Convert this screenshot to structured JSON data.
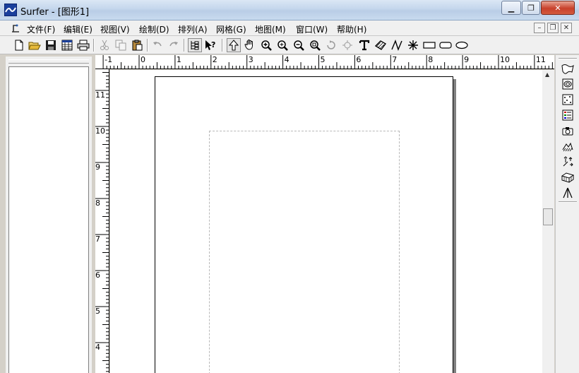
{
  "window": {
    "title": "Surfer - [图形1]"
  },
  "menubar": {
    "items": [
      "文件(F)",
      "编辑(E)",
      "视图(V)",
      "绘制(D)",
      "排列(A)",
      "网格(G)",
      "地图(M)",
      "窗口(W)",
      "帮助(H)"
    ]
  },
  "toolbar": {
    "buttons": [
      "new-document",
      "open-folder",
      "save",
      "worksheet",
      "print",
      "cut",
      "copy",
      "paste",
      "undo",
      "redo",
      "object-manager",
      "context-help",
      "select-arrow",
      "pan-hand",
      "zoom-in",
      "zoom-rectangle",
      "zoom-out",
      "zoom-page",
      "rotate",
      "reshape",
      "text",
      "polygon",
      "polyline",
      "symbol",
      "rectangle",
      "rounded-rectangle",
      "ellipse"
    ]
  },
  "ruler_h": {
    "labels": [
      "-1",
      "0",
      "1",
      "2",
      "3",
      "4",
      "5",
      "6",
      "7",
      "8",
      "9",
      "10",
      "11"
    ]
  },
  "ruler_v": {
    "labels": [
      "11",
      "10",
      "9",
      "8",
      "7",
      "6",
      "5",
      "4"
    ]
  },
  "right_toolbar": {
    "buttons": [
      "base-map",
      "contour-map",
      "post-map",
      "classed-post-map",
      "image-map",
      "shaded-relief-map",
      "vector-map",
      "3d-wireframe",
      "3d-surface"
    ]
  }
}
